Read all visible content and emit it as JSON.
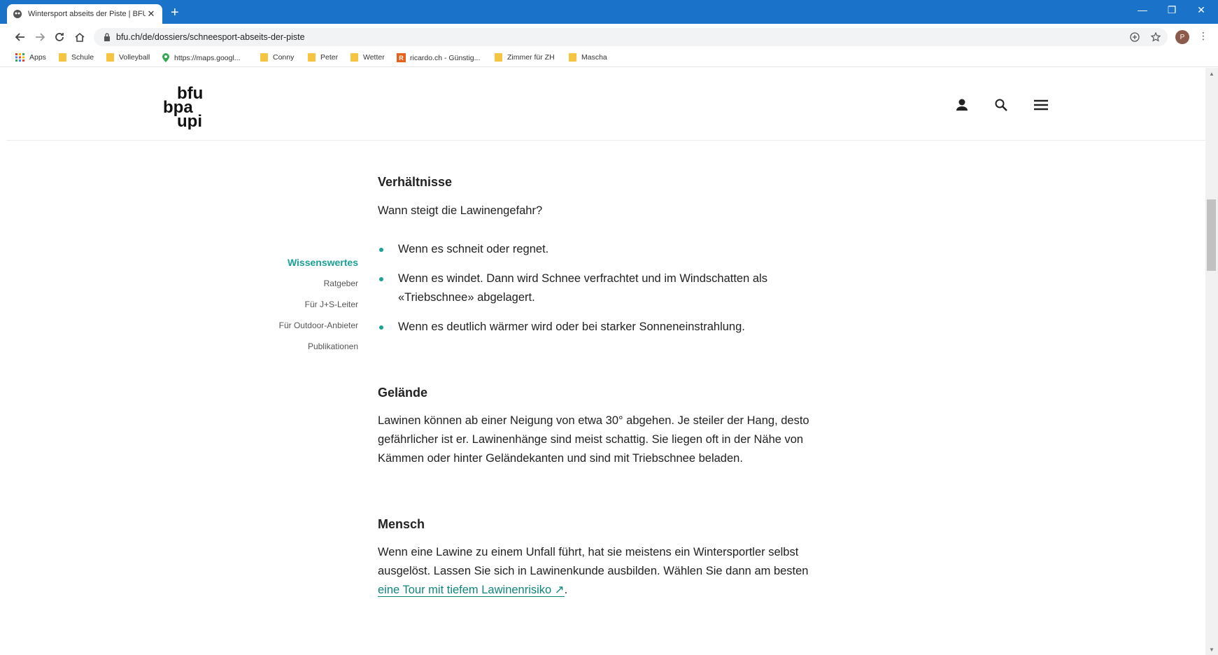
{
  "browser": {
    "tab_title": "Wintersport abseits der Piste | BFU",
    "new_tab": "+",
    "url": "bfu.ch/de/dossiers/schneesport-abseits-der-piste",
    "avatar_initial": "P",
    "window_controls": [
      "—",
      "❐",
      "✕"
    ],
    "accent_color": "#1a73c8"
  },
  "bookmarks": [
    {
      "label": "Apps",
      "icon": "apps-grid-icon"
    },
    {
      "label": "Schule",
      "icon": "folder-icon"
    },
    {
      "label": "Volleyball",
      "icon": "folder-icon"
    },
    {
      "label": "https://maps.googl...",
      "icon": "maps-pin-icon"
    },
    {
      "label": "Conny",
      "icon": "folder-icon"
    },
    {
      "label": "Peter",
      "icon": "folder-icon"
    },
    {
      "label": "Wetter",
      "icon": "folder-icon"
    },
    {
      "label": "ricardo.ch - Günstig...",
      "icon": "ricardo-icon"
    },
    {
      "label": "Zimmer für ZH",
      "icon": "folder-icon"
    },
    {
      "label": "Mascha",
      "icon": "folder-icon"
    }
  ],
  "site": {
    "logo_lines": [
      "bfu",
      "bpa",
      "upi"
    ],
    "brand_color": "#1aa296"
  },
  "sidenav": [
    {
      "label": "Wissenswertes",
      "active": true
    },
    {
      "label": "Ratgeber",
      "active": false
    },
    {
      "label": "Für J+S-Leiter",
      "active": false
    },
    {
      "label": "Für Outdoor-Anbieter",
      "active": false
    },
    {
      "label": "Publikationen",
      "active": false
    }
  ],
  "content": {
    "s1_title": "Verhältnisse",
    "s1_intro": "Wann steigt die Lawinengefahr?",
    "s1_bullets": [
      "Wenn es schneit oder regnet.",
      "Wenn es windet. Dann wird Schnee verfrachtet und im Windschatten als «Triebschnee» abgelagert.",
      "Wenn es deutlich wärmer wird oder bei starker Sonneneinstrahlung."
    ],
    "s2_title": "Gelände",
    "s2_text": "Lawinen können ab einer Neigung von etwa 30° abgehen. Je steiler der Hang, desto gefährlicher ist er. Lawinenhänge sind meist schattig. Sie liegen oft in der Nähe von Kämmen oder hinter Geländekanten und sind mit Triebschnee beladen.",
    "s3_title": "Mensch",
    "s3_text": "Wenn eine Lawine zu einem Unfall führt, hat sie meistens ein Wintersportler selbst ausgelöst. Lassen Sie sich in Lawinenkunde ausbilden. Wählen Sie dann am besten ",
    "s3_link": "eine Tour mit tiefem Lawinenrisiko ↗",
    "s3_end": "."
  }
}
